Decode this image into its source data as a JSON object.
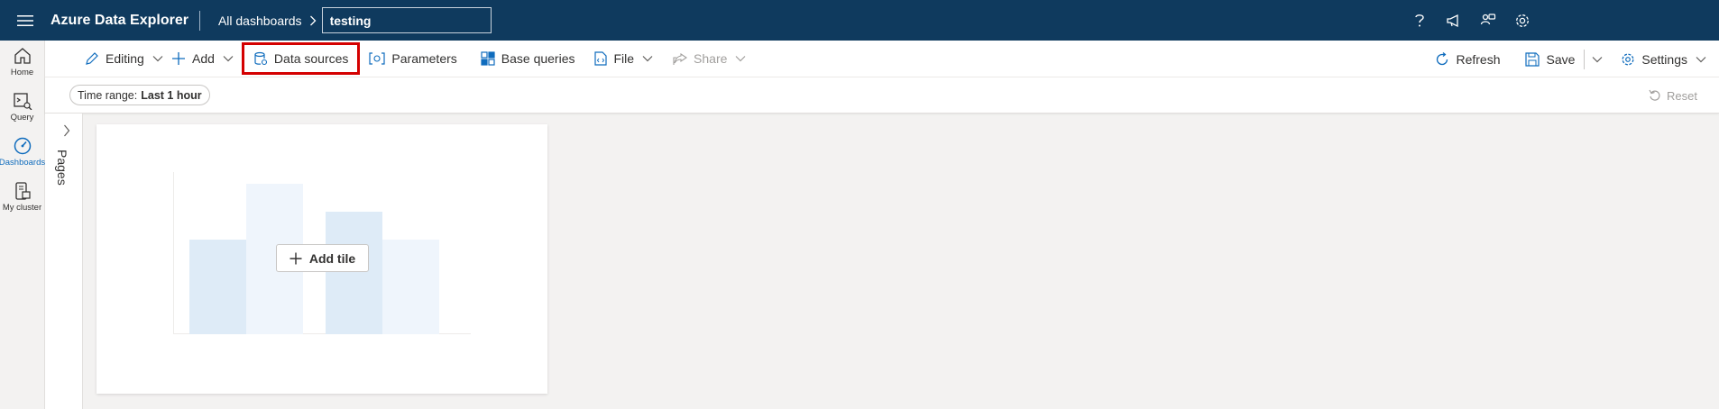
{
  "topbar": {
    "app_title": "Azure Data Explorer",
    "breadcrumb": "All dashboards",
    "dashboard_name": "testing",
    "icons": [
      "help-icon",
      "announcement-icon",
      "feedback-icon",
      "settings-icon"
    ]
  },
  "rail": {
    "items": [
      {
        "label": "Home",
        "icon": "home-icon"
      },
      {
        "label": "Query",
        "icon": "query-icon"
      },
      {
        "label": "Dashboards",
        "icon": "dashboards-icon",
        "active": true
      },
      {
        "label": "My cluster",
        "icon": "my-cluster-icon"
      }
    ]
  },
  "toolbar": {
    "editing": "Editing",
    "add": "Add",
    "data_sources": "Data sources",
    "parameters": "Parameters",
    "base_queries": "Base queries",
    "file": "File",
    "share": "Share",
    "refresh": "Refresh",
    "save": "Save",
    "settings": "Settings"
  },
  "filter": {
    "time_range_label": "Time range:",
    "time_range_value": "Last 1 hour",
    "reset": "Reset"
  },
  "pages": {
    "label": "Pages"
  },
  "canvas": {
    "add_tile": "Add tile"
  },
  "colors": {
    "topbar": "#0f3a5e",
    "accent": "#0f6cbd",
    "highlight": "#d40000",
    "placeholder_bar_dark": "#deebf7",
    "placeholder_bar_light": "#eff5fc"
  }
}
